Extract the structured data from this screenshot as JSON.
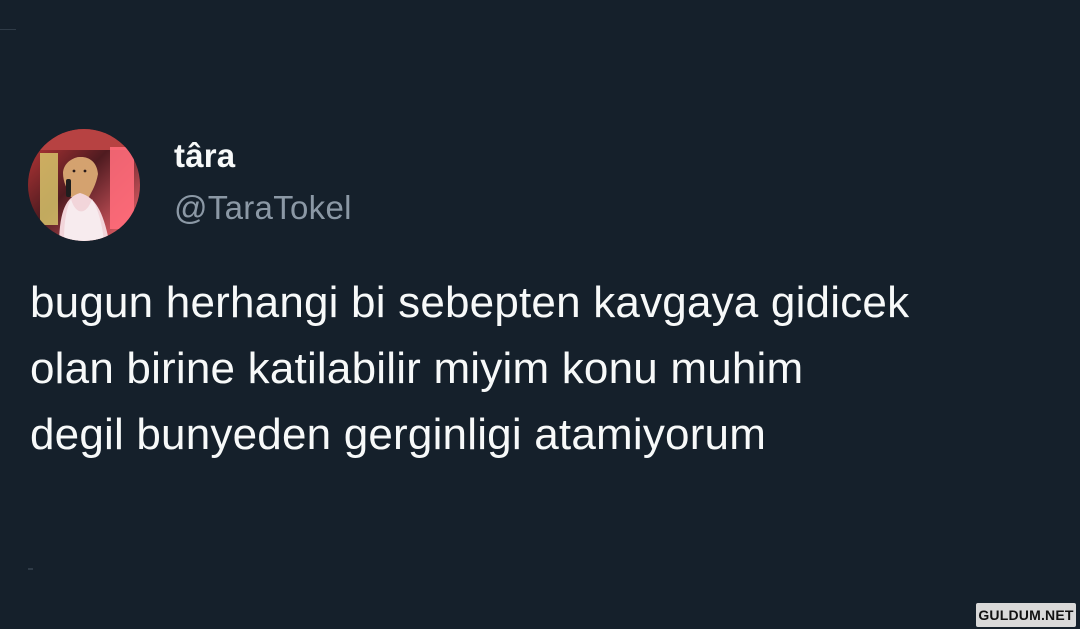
{
  "tweet": {
    "author": {
      "display_name": "târa",
      "handle": "@TaraTokel",
      "avatar_icon": "profile-photo"
    },
    "text_lines": [
      "bugun herhangi bi sebepten kavgaya gidicek",
      "olan birine katilabilir miyim konu muhim",
      "degil bunyeden gerginligi atamiyorum"
    ]
  },
  "watermark": {
    "text": "GULDUM.NET"
  },
  "colors": {
    "background": "#15202b",
    "primary_text": "#f7f9f9",
    "secondary_text": "#8b98a5",
    "watermark_bg": "#d9d9d9"
  }
}
